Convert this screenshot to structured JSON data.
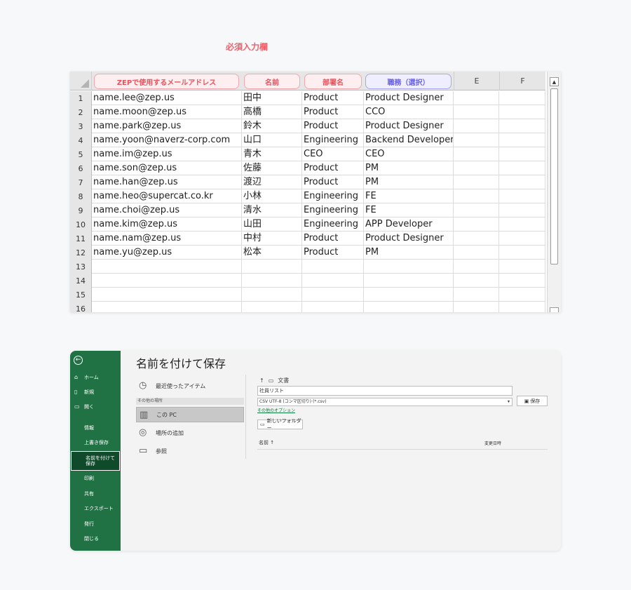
{
  "annotation": {
    "title": "必須入力欄",
    "arc_color": "#f0606a"
  },
  "sheet": {
    "columns": [
      {
        "label": "ZEPで使用するメールアドレス",
        "style": "required"
      },
      {
        "label": "名前",
        "style": "required"
      },
      {
        "label": "部署名",
        "style": "required"
      },
      {
        "label": "職務（選択）",
        "style": "optional"
      },
      {
        "label": "E",
        "style": "letter"
      },
      {
        "label": "F",
        "style": "letter"
      }
    ],
    "rows": [
      {
        "num": "1",
        "email": "name.lee@zep.us",
        "name": "田中",
        "dept": "Product",
        "role": "Product Designer"
      },
      {
        "num": "2",
        "email": "name.moon@zep.us",
        "name": "高橋",
        "dept": "Product",
        "role": "CCO"
      },
      {
        "num": "3",
        "email": "name.park@zep.us",
        "name": "鈴木",
        "dept": "Product",
        "role": "Product Designer"
      },
      {
        "num": "4",
        "email": "name.yoon@naverz-corp.com",
        "name": "山口",
        "dept": "Engineering",
        "role": "Backend Developer"
      },
      {
        "num": "5",
        "email": "name.im@zep.us",
        "name": "青木",
        "dept": "CEO",
        "role": "CEO"
      },
      {
        "num": "6",
        "email": "name.son@zep.us",
        "name": "佐藤",
        "dept": "Product",
        "role": "PM"
      },
      {
        "num": "7",
        "email": "name.han@zep.us",
        "name": "渡辺",
        "dept": "Product",
        "role": "PM"
      },
      {
        "num": "8",
        "email": "name.heo@supercat.co.kr",
        "name": "小林",
        "dept": "Engineering",
        "role": "FE"
      },
      {
        "num": "9",
        "email": "name.choi@zep.us",
        "name": "清水",
        "dept": "Engineering",
        "role": "FE"
      },
      {
        "num": "10",
        "email": "name.kim@zep.us",
        "name": "山田",
        "dept": "Engineering",
        "role": "APP Developer"
      },
      {
        "num": "11",
        "email": "name.nam@zep.us",
        "name": "中村",
        "dept": "Product",
        "role": "Product Designer"
      },
      {
        "num": "12",
        "email": "name.yu@zep.us",
        "name": "松本",
        "dept": "Product",
        "role": "PM"
      },
      {
        "num": "13",
        "email": "",
        "name": "",
        "dept": "",
        "role": ""
      },
      {
        "num": "14",
        "email": "",
        "name": "",
        "dept": "",
        "role": ""
      },
      {
        "num": "15",
        "email": "",
        "name": "",
        "dept": "",
        "role": ""
      },
      {
        "num": "16",
        "email": "",
        "name": "",
        "dept": "",
        "role": ""
      }
    ]
  },
  "dialog": {
    "sidebar": {
      "home": "ホーム",
      "new": "新規",
      "open": "開く",
      "info": "情報",
      "save_overwrite": "上書き保存",
      "save_as": "名前を付けて保存",
      "print": "印刷",
      "share": "共有",
      "export": "エクスポート",
      "publish": "発行",
      "close": "閉じる"
    },
    "title": "名前を付けて保存",
    "locations": {
      "recent": "最近使ったアイテム",
      "other_places": "その他の場所",
      "this_pc": "この PC",
      "add_place": "場所の追加",
      "browse": "参照"
    },
    "path": "文書",
    "file_name": "社員リスト",
    "file_type": "CSV UTF-8 (コンマ区切り) (*.csv)",
    "more_options": "その他のオプション",
    "save_label": "保存",
    "new_folder_label": "新しいフォルダー",
    "list_headers": {
      "name": "名前",
      "modified": "変更日時"
    }
  }
}
